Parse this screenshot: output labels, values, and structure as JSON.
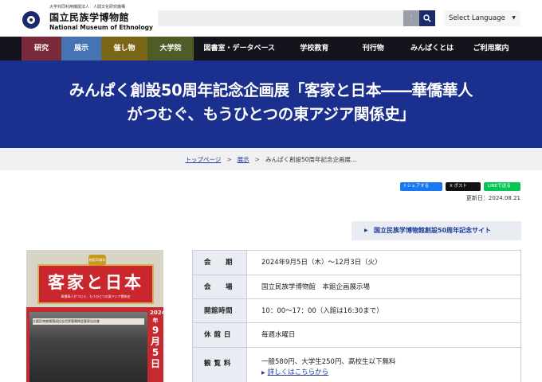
{
  "header": {
    "logo_sub": "大学共同利用機関法人　人間文化研究機構",
    "logo_jp": "国立民族学博物館",
    "logo_en": "National Museum of Ethnology",
    "search": {
      "placeholder": "",
      "adv_icon": "sliders-icon",
      "button_icon": "search-icon"
    },
    "language": {
      "selected": "Select Language"
    }
  },
  "nav": {
    "items": [
      {
        "label": "研究",
        "color": "#7a2a3a"
      },
      {
        "label": "展示",
        "color": "#4673b3"
      },
      {
        "label": "催し物",
        "color": "#7b6516"
      },
      {
        "label": "大学院",
        "color": "#4e5d27"
      },
      {
        "label": "図書室・データベース",
        "color": "#14141c"
      },
      {
        "label": "学校教育",
        "color": "#14141c"
      },
      {
        "label": "刊行物",
        "color": "#14141c"
      },
      {
        "label": "みんぱくとは",
        "color": "#14141c"
      },
      {
        "label": "ご利用案内",
        "color": "#14141c"
      }
    ]
  },
  "hero": {
    "title": "みんぱく創設50周年記念企画展「客家と日本――華僑華人\nがつむぐ、もうひとつの東アジア関係史」",
    "bg_color": "#1a2f8e"
  },
  "breadcrumb": {
    "items": [
      "トップページ",
      "展示",
      "みんぱく創設50周年記念企画展…"
    ],
    "separator": ">"
  },
  "share": {
    "facebook": "f シェアする",
    "x": "X ポスト",
    "line": "LINEで送る"
  },
  "updated": "更新日：2024.08.21",
  "anniversary_link": "国立民族学博物館創設50周年記念サイト",
  "poster": {
    "badge": "創設50周年",
    "title": "客家と日本",
    "subtitle": "華僑華人がつむぐ、もうひとつの東アジア関係史",
    "date_small": "2024年",
    "date_big": "9月5日",
    "banner": "大阪民衆劇場落成記念世界客属總会客家自治會"
  },
  "info": {
    "rows": [
      {
        "label": "会　　期",
        "value": "2024年9月5日（木）～12月3日（火）"
      },
      {
        "label": "会　　場",
        "value": "国立民族学博物館　本館企画展示場"
      },
      {
        "label": "開館時間",
        "value": "10：00～17：00（入館は16:30まで）"
      },
      {
        "label": "休 館 日",
        "value": "毎週水曜日"
      },
      {
        "label": "観 覧 料",
        "value": "一般580円、大学生250円、高校生以下無料",
        "link": "詳しくはこちらから"
      }
    ]
  }
}
